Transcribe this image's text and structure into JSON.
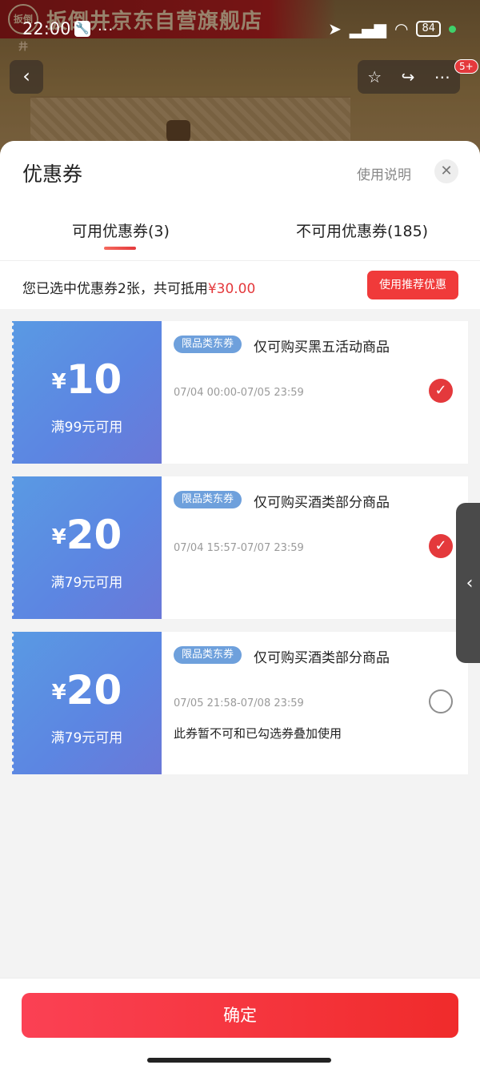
{
  "status_bar": {
    "time": "22:00",
    "dots": "...",
    "battery": "84"
  },
  "background_page": {
    "store_name": "扳倒井京东自营旗舰店",
    "logo_text": "扳倒井",
    "cart_badge": "5+"
  },
  "sheet": {
    "title": "优惠券",
    "help_link": "使用说明",
    "tabs": [
      {
        "label": "可用优惠券(3)",
        "active": true
      },
      {
        "label": "不可用优惠券(185)",
        "active": false
      }
    ],
    "summary_prefix": "您已选中优惠券2张，共可抵用",
    "summary_amount": "¥30.00",
    "recommend_button": "使用推荐优惠"
  },
  "coupons": [
    {
      "yen": "¥",
      "amount": "10",
      "condition": "满99元可用",
      "tag": "限品类东券",
      "description": "仅可购买黑五活动商品",
      "period": "07/04 00:00-07/05 23:59",
      "warning": "",
      "selected": true
    },
    {
      "yen": "¥",
      "amount": "20",
      "condition": "满79元可用",
      "tag": "限品类东券",
      "description": "仅可购买酒类部分商品",
      "period": "07/04 15:57-07/07 23:59",
      "warning": "",
      "selected": true
    },
    {
      "yen": "¥",
      "amount": "20",
      "condition": "满79元可用",
      "tag": "限品类东券",
      "description": "仅可购买酒类部分商品",
      "period": "07/05 21:58-07/08 23:59",
      "warning": "此券暂不可和已勾选券叠加使用",
      "selected": false
    }
  ],
  "footer": {
    "confirm_button": "确定"
  },
  "colors": {
    "accent_red": "#e4393c",
    "coupon_blue": "#5c86e2"
  }
}
